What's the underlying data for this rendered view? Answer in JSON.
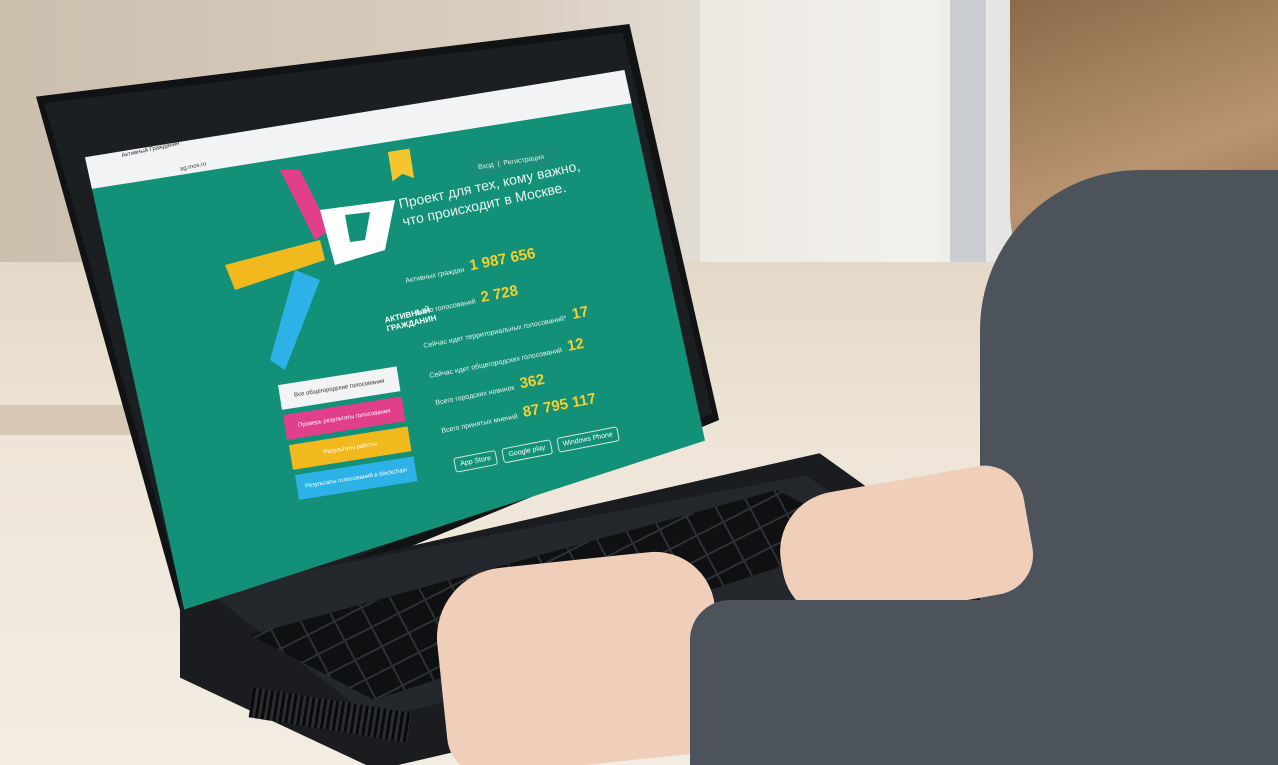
{
  "browser": {
    "tab_title": "Активный Гражданин",
    "url": "ag.mos.ru"
  },
  "site": {
    "auth_links": [
      "Вход",
      "Регистрация"
    ],
    "logo_text": [
      "АКТИВНЫЙ",
      "ГРАЖДАНИН"
    ],
    "tagline": [
      "Проект для тех, кому важно,",
      "что происходит в Москве."
    ],
    "stats": [
      {
        "label": "Активных граждан",
        "value": "1 987 656"
      },
      {
        "label": "Всего голосований",
        "value": "2 728"
      },
      {
        "label": "Сейчас идет территориальных голосований*",
        "value": "17"
      },
      {
        "label": "Сейчас идет общегородских голосований",
        "value": "12"
      },
      {
        "label": "Всего городских новинок",
        "value": "362"
      },
      {
        "label": "Всего принятых мнений",
        "value": "87 795 117"
      }
    ],
    "buttons": [
      {
        "label": "Все общегородские голосования",
        "color": "#f2f3f4",
        "text_color": "#333333"
      },
      {
        "label": "Проверь результаты голосования",
        "color": "#e23f8a",
        "text_color": "#ffffff"
      },
      {
        "label": "Результаты работы",
        "color": "#f1b91d",
        "text_color": "#ffffff"
      },
      {
        "label": "Результаты голосований в blockchain",
        "color": "#2cb2e6",
        "text_color": "#ffffff"
      }
    ],
    "stores": [
      "App Store",
      "Google play",
      "Windows Phone"
    ]
  },
  "colors": {
    "site_bg": "#139078",
    "accent_yellow": "#f6d02b",
    "logo_pink": "#e23f8a",
    "logo_yellow": "#f1b91d",
    "logo_blue": "#2cb2e6"
  }
}
